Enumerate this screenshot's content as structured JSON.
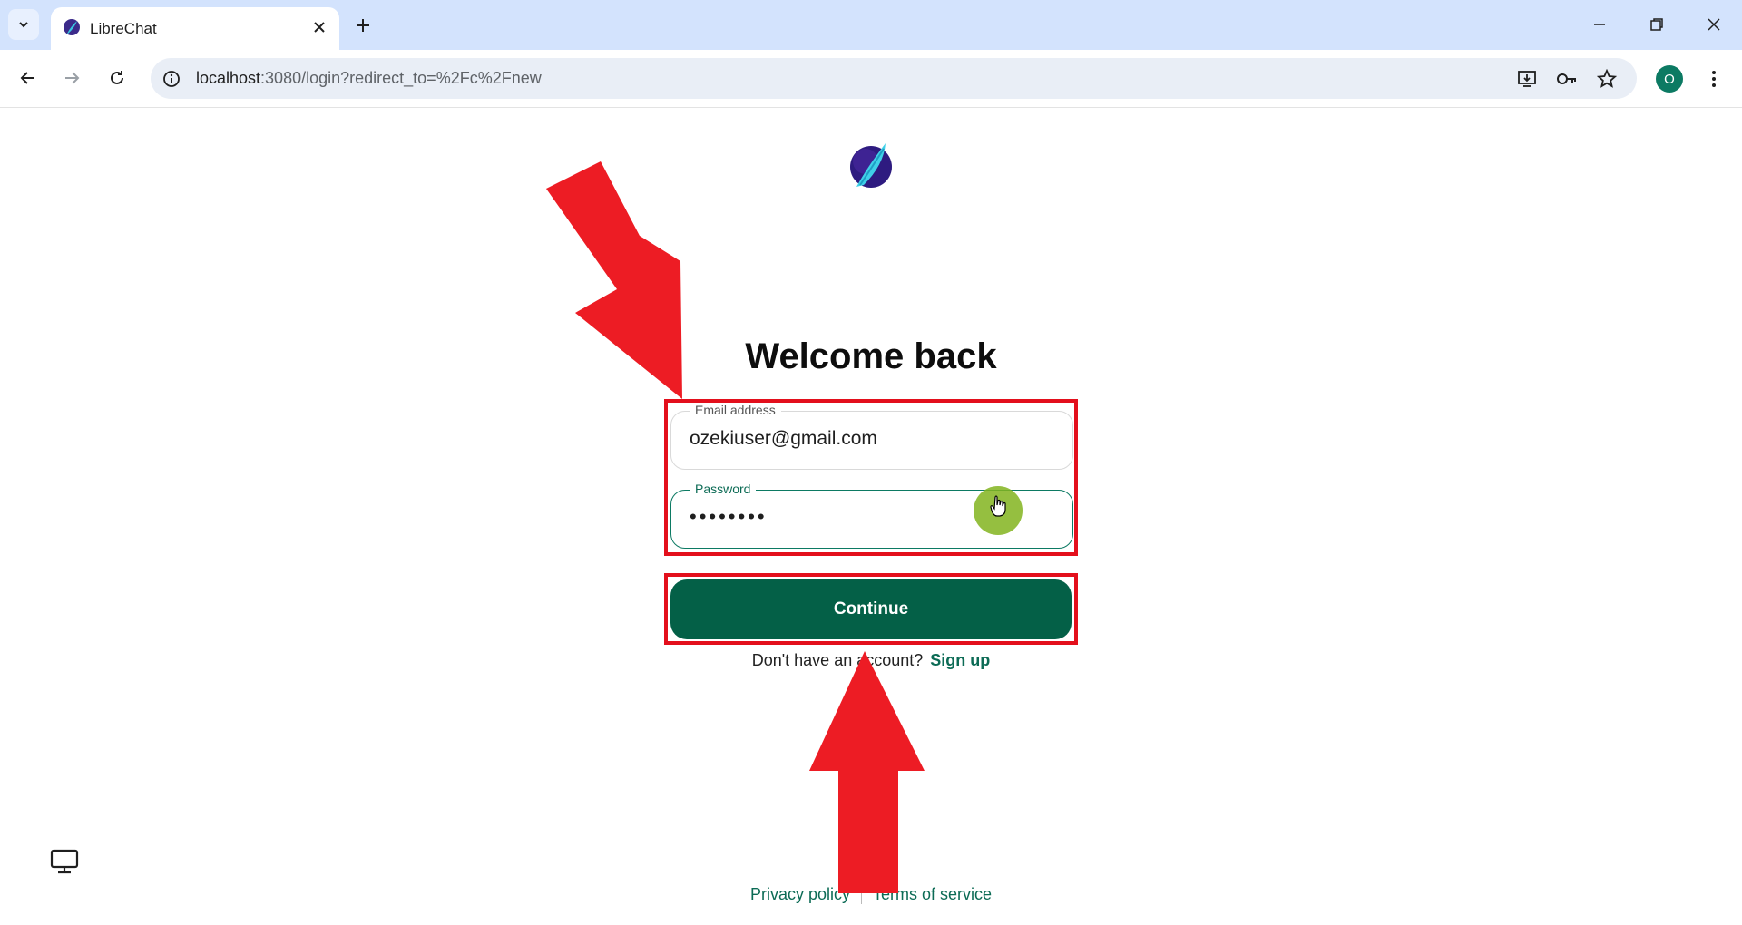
{
  "browser": {
    "tab_title": "LibreChat",
    "url_host": "localhost",
    "url_path": ":3080/login?redirect_to=%2Fc%2Fnew",
    "profile_initial": "O"
  },
  "login": {
    "heading": "Welcome back",
    "email_label": "Email address",
    "email_value": "ozekiuser@gmail.com",
    "password_label": "Password",
    "password_value": "••••••••",
    "continue_label": "Continue",
    "no_account_text": "Don't have an account?",
    "signup_label": "Sign up"
  },
  "footer": {
    "privacy_label": "Privacy policy",
    "terms_label": "Terms of service"
  },
  "colors": {
    "brand_green": "#046047",
    "annotation_red": "#e30f1c",
    "tab_strip": "#d3e3fd"
  },
  "icons": [
    "tab-search-icon",
    "librechat-favicon-icon",
    "close-icon",
    "plus-icon",
    "minimize-icon",
    "restore-icon",
    "back-icon",
    "forward-icon",
    "reload-icon",
    "site-info-icon",
    "install-icon",
    "key-icon",
    "star-icon",
    "kebab-icon",
    "monitor-icon"
  ]
}
